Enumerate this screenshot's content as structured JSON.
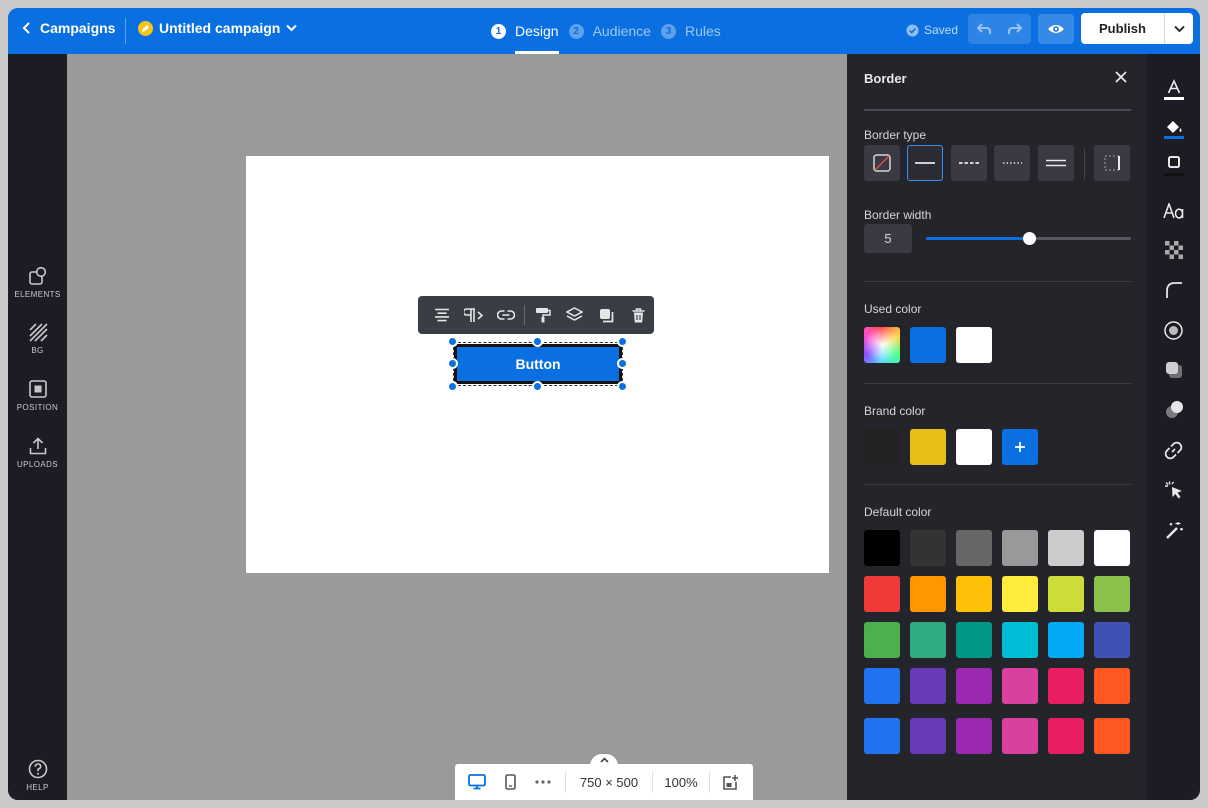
{
  "header": {
    "back_label": "Campaigns",
    "campaign_name": "Untitled campaign",
    "steps": [
      {
        "num": "1",
        "label": "Design"
      },
      {
        "num": "2",
        "label": "Audience"
      },
      {
        "num": "3",
        "label": "Rules"
      }
    ],
    "active_step": "Design",
    "saved_label": "Saved",
    "publish_label": "Publish"
  },
  "left_nav": {
    "items": [
      {
        "label": "ELEMENTS",
        "icon": "elements-icon"
      },
      {
        "label": "BG",
        "icon": "background-icon"
      },
      {
        "label": "POSITION",
        "icon": "position-icon"
      },
      {
        "label": "UPLOADS",
        "icon": "upload-icon"
      }
    ],
    "help_label": "HELP"
  },
  "canvas": {
    "button_text": "Button",
    "canvas_size": "750 × 500",
    "zoom": "100%"
  },
  "panel": {
    "title": "Border",
    "border_type_label": "Border type",
    "border_types": [
      "none",
      "solid",
      "dashed",
      "dotted",
      "double"
    ],
    "active_border_type": "solid",
    "border_width_label": "Border width",
    "border_width_value": "5",
    "border_width_fraction": 0.5,
    "used_color_label": "Used color",
    "used_colors": [
      "gradient",
      "#0a6fe0",
      "#ffffff"
    ],
    "brand_color_label": "Brand color",
    "brand_colors": [
      "#222222",
      "#e6c017",
      "#ffffff"
    ],
    "default_color_label": "Default color",
    "default_colors": [
      [
        "#000000",
        "#333333",
        "#666666",
        "#999999",
        "#cccccc",
        "#ffffff"
      ],
      [
        "#f03a3a",
        "#ff9800",
        "#ffc107",
        "#ffeb3b",
        "#cddc39",
        "#8bc34a"
      ],
      [
        "#4caf50",
        "#2fad80",
        "#009688",
        "#00bcd4",
        "#03a9f4",
        "#3f51b5"
      ],
      [
        "#2174f0",
        "#673ab7",
        "#9c27b0",
        "#d9419e",
        "#e91e63",
        "#ff5722"
      ],
      [
        "#2174f0",
        "#673ab7",
        "#9c27b0",
        "#d9419e",
        "#e91e63",
        "#ff5722"
      ]
    ]
  },
  "colors": {
    "accent": "#0a6fe0",
    "panel_bg": "#24252b",
    "nav_bg": "#1c1d24"
  }
}
